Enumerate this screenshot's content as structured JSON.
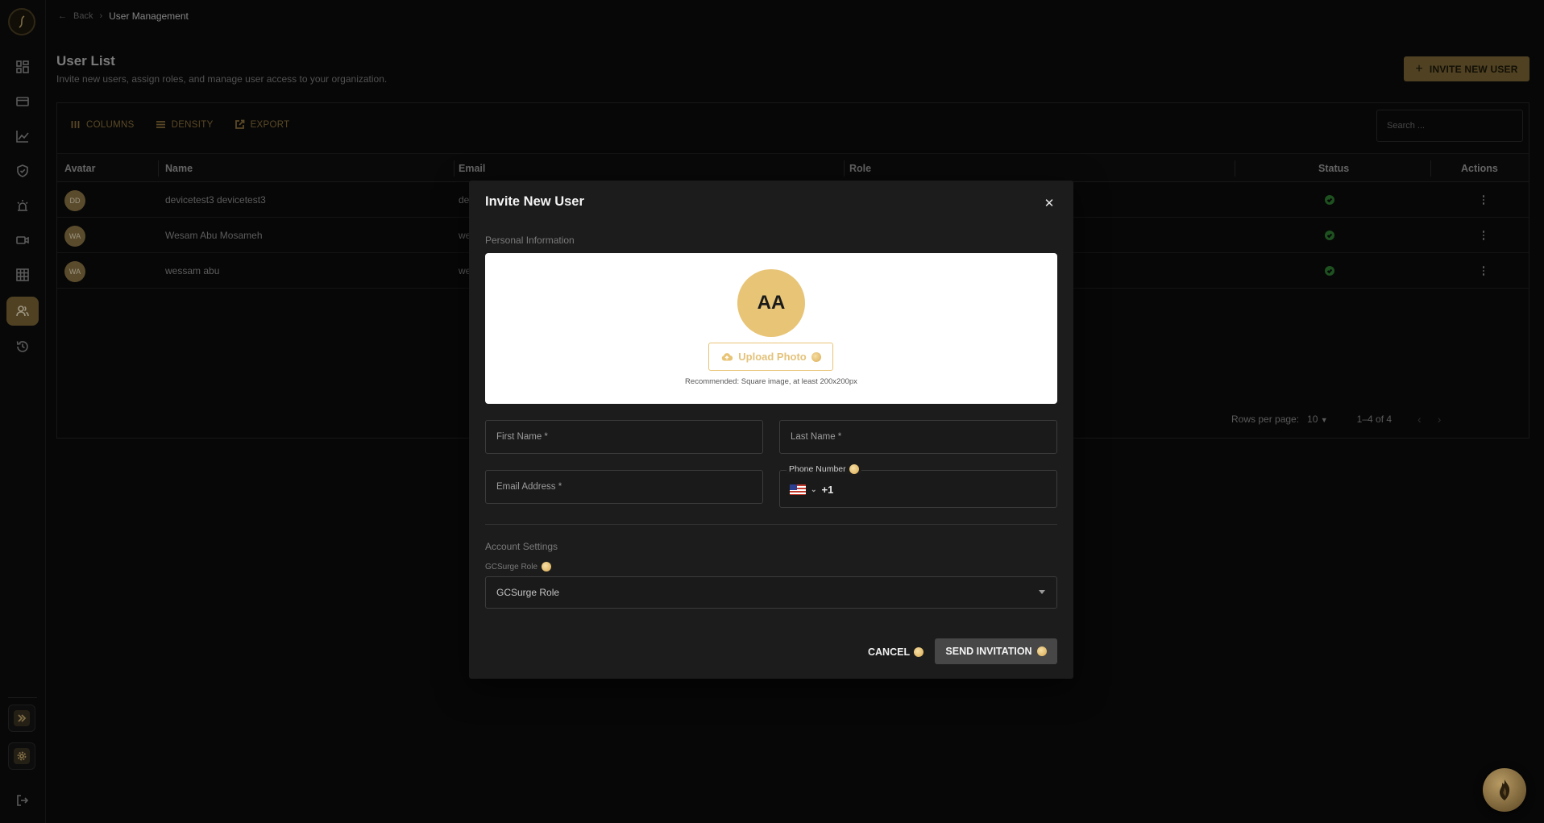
{
  "breadcrumb": {
    "back": "Back",
    "current": "User Management"
  },
  "header": {
    "title": "User List",
    "subtitle": "Invite new users, assign roles, and manage user access to your organization.",
    "invite_label": "INVITE NEW USER"
  },
  "toolbar": {
    "columns": "COLUMNS",
    "density": "DENSITY",
    "export": "EXPORT",
    "search_placeholder": "Search ..."
  },
  "table": {
    "columns": [
      "Avatar",
      "Name",
      "Email",
      "Role",
      "Status",
      "Actions"
    ],
    "rows": [
      {
        "initials": "DD",
        "name": "devicetest3 devicetest3",
        "email_partial": "de"
      },
      {
        "initials": "WA",
        "name": "Wesam Abu Mosameh",
        "email_partial": "we"
      },
      {
        "initials": "WA",
        "name": "wessam abu",
        "email_partial": "we"
      }
    ]
  },
  "pagination": {
    "rows_label": "Rows per page:",
    "rows_value": "10",
    "range": "1–4 of 4"
  },
  "modal": {
    "title": "Invite New User",
    "personal_section": "Personal Information",
    "avatar_initials": "AA",
    "upload_label": "Upload Photo",
    "recommendation": "Recommended: Square image, at least 200x200px",
    "first_name": "First Name *",
    "last_name": "Last Name *",
    "email": "Email Address *",
    "phone_label": "Phone Number",
    "phone_code": "+1",
    "account_section": "Account Settings",
    "role_label": "GCSurge Role",
    "role_value": "GCSurge Role",
    "cancel": "CANCEL",
    "send": "SEND INVITATION"
  },
  "colors": {
    "accent": "#7a6435",
    "gold": "#e8c476",
    "success": "#2e7d32"
  }
}
